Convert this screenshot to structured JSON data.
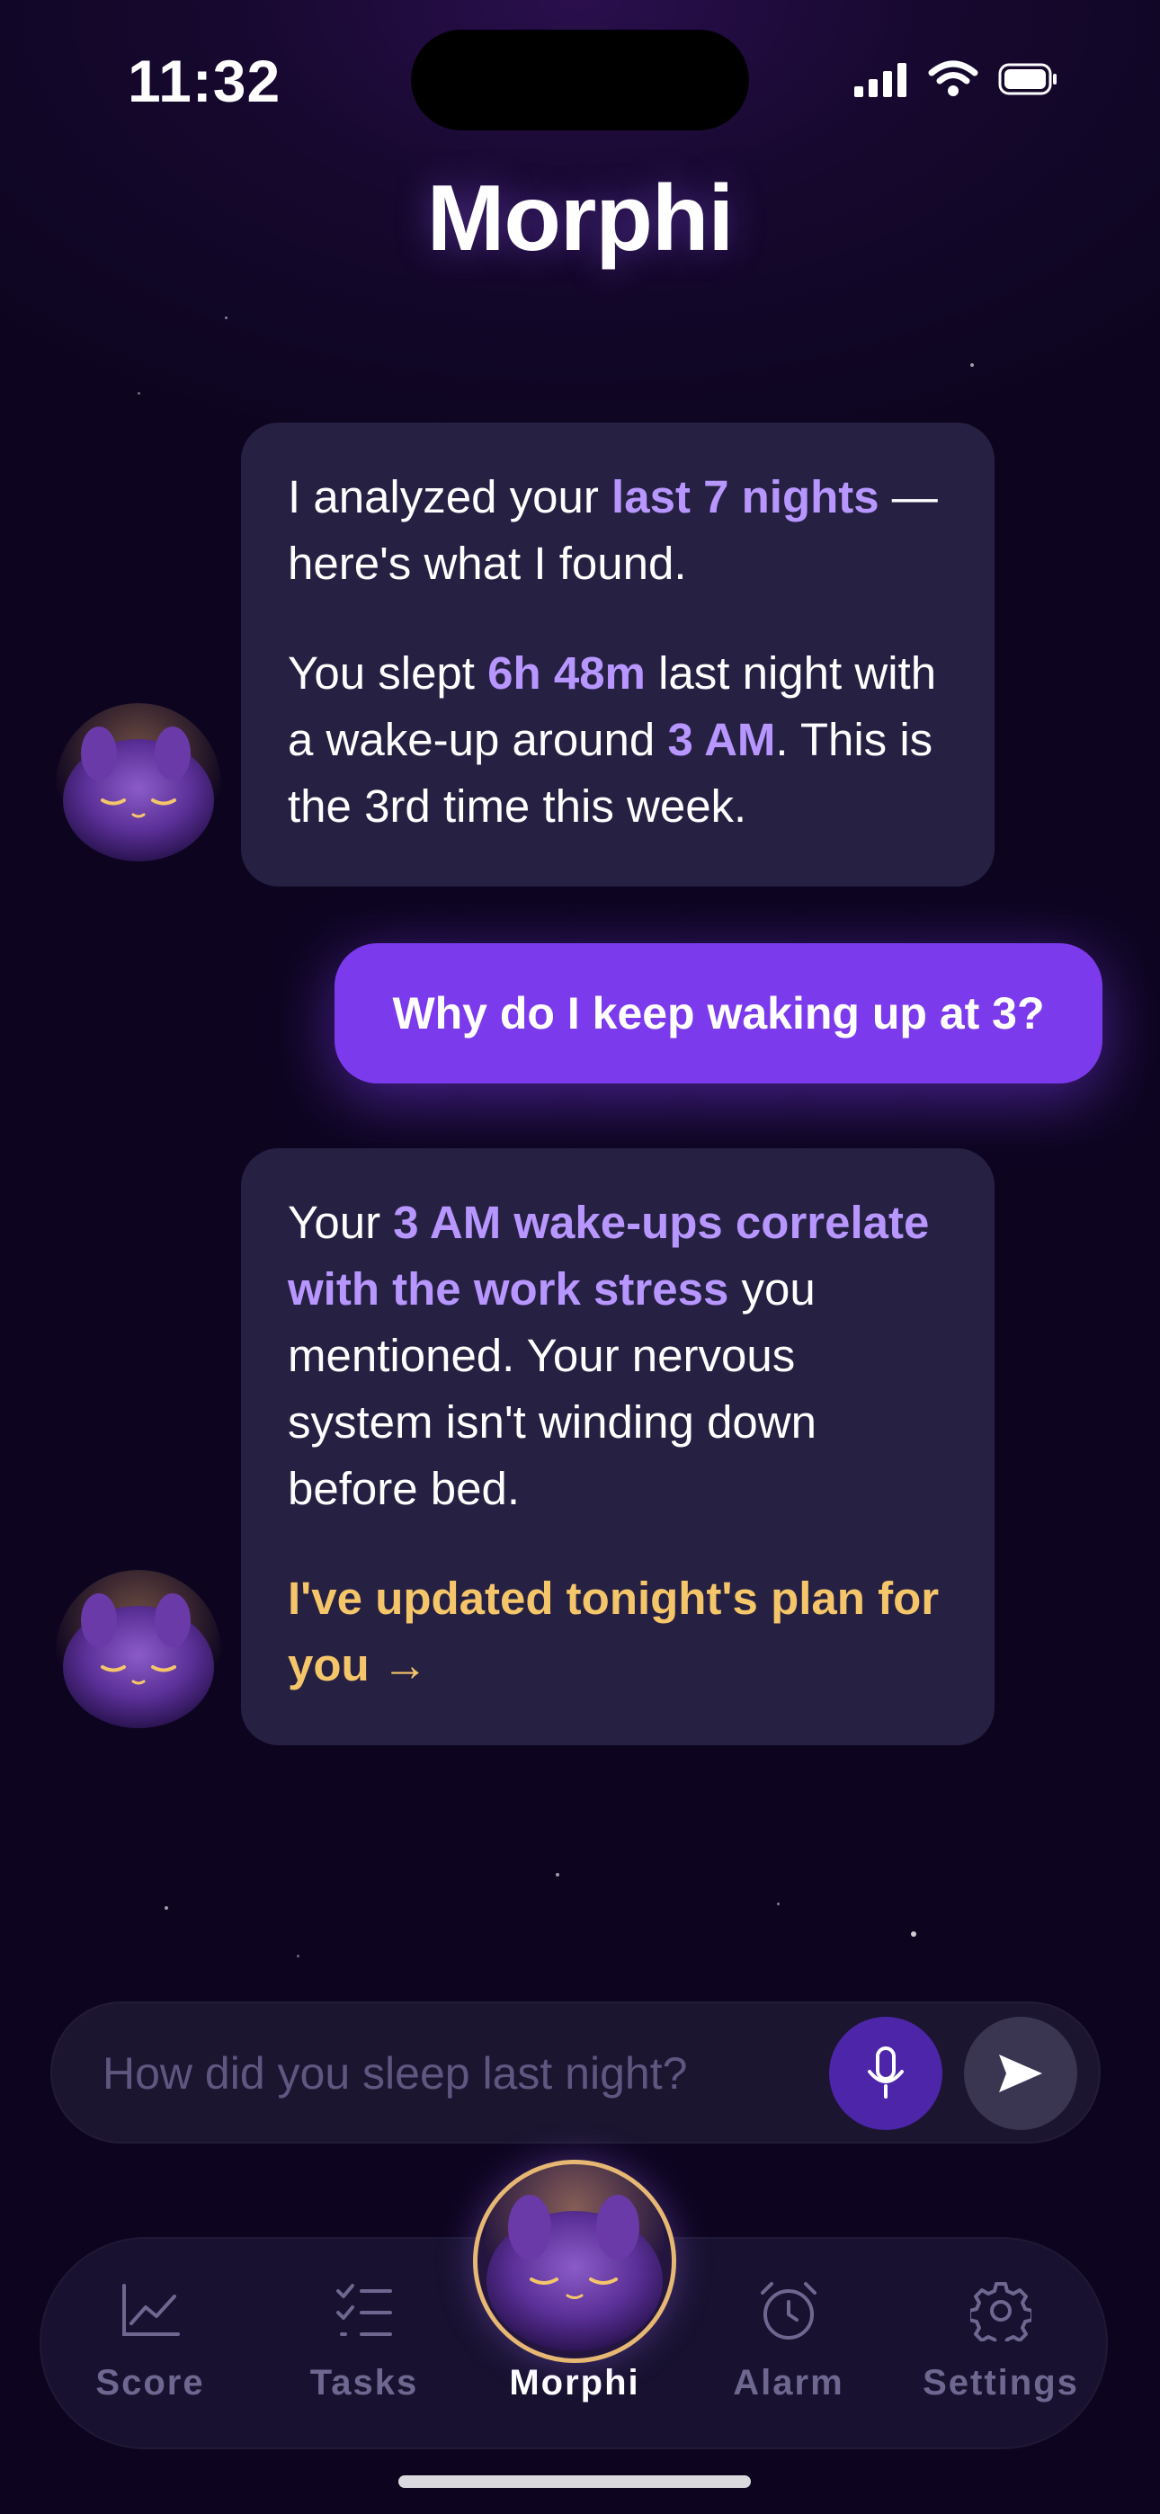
{
  "status_bar": {
    "time": "11:32"
  },
  "header": {
    "title": "Morphi"
  },
  "chat": {
    "message_1": {
      "p1_pre": "I analyzed your ",
      "p1_hl": "last 7 nights",
      "p1_post": " — here's what I found.",
      "p2_a": "You slept ",
      "p2_hl1": "6h 48m",
      "p2_b": " last night with a wake-up around ",
      "p2_hl2": "3 AM",
      "p2_c": ". This is the 3rd time this week."
    },
    "user_message": "Why do I keep waking up at 3?",
    "message_2": {
      "p1_pre": "Your ",
      "p1_hl": "3 AM wake-ups correlate with the work stress",
      "p1_post": " you mentioned. Your nervous system isn't winding down before bed.",
      "link": "I've updated tonight's plan for you →"
    }
  },
  "composer": {
    "placeholder": "How did you sleep last night?"
  },
  "tab_bar": {
    "score": "Score",
    "tasks": "Tasks",
    "morphi": "Morphi",
    "alarm": "Alarm",
    "settings": "Settings",
    "active": "Morphi"
  },
  "colors": {
    "background": "#0d0520",
    "bubble": "#262042",
    "accent": "#7c3aed",
    "highlight": "#b896ff",
    "gold": "#f5c56a"
  },
  "icons": [
    "signal-icon",
    "wifi-icon",
    "battery-icon",
    "mic-icon",
    "send-icon",
    "chart-icon",
    "checklist-icon",
    "alarm-icon",
    "gear-icon",
    "morphi-avatar"
  ]
}
